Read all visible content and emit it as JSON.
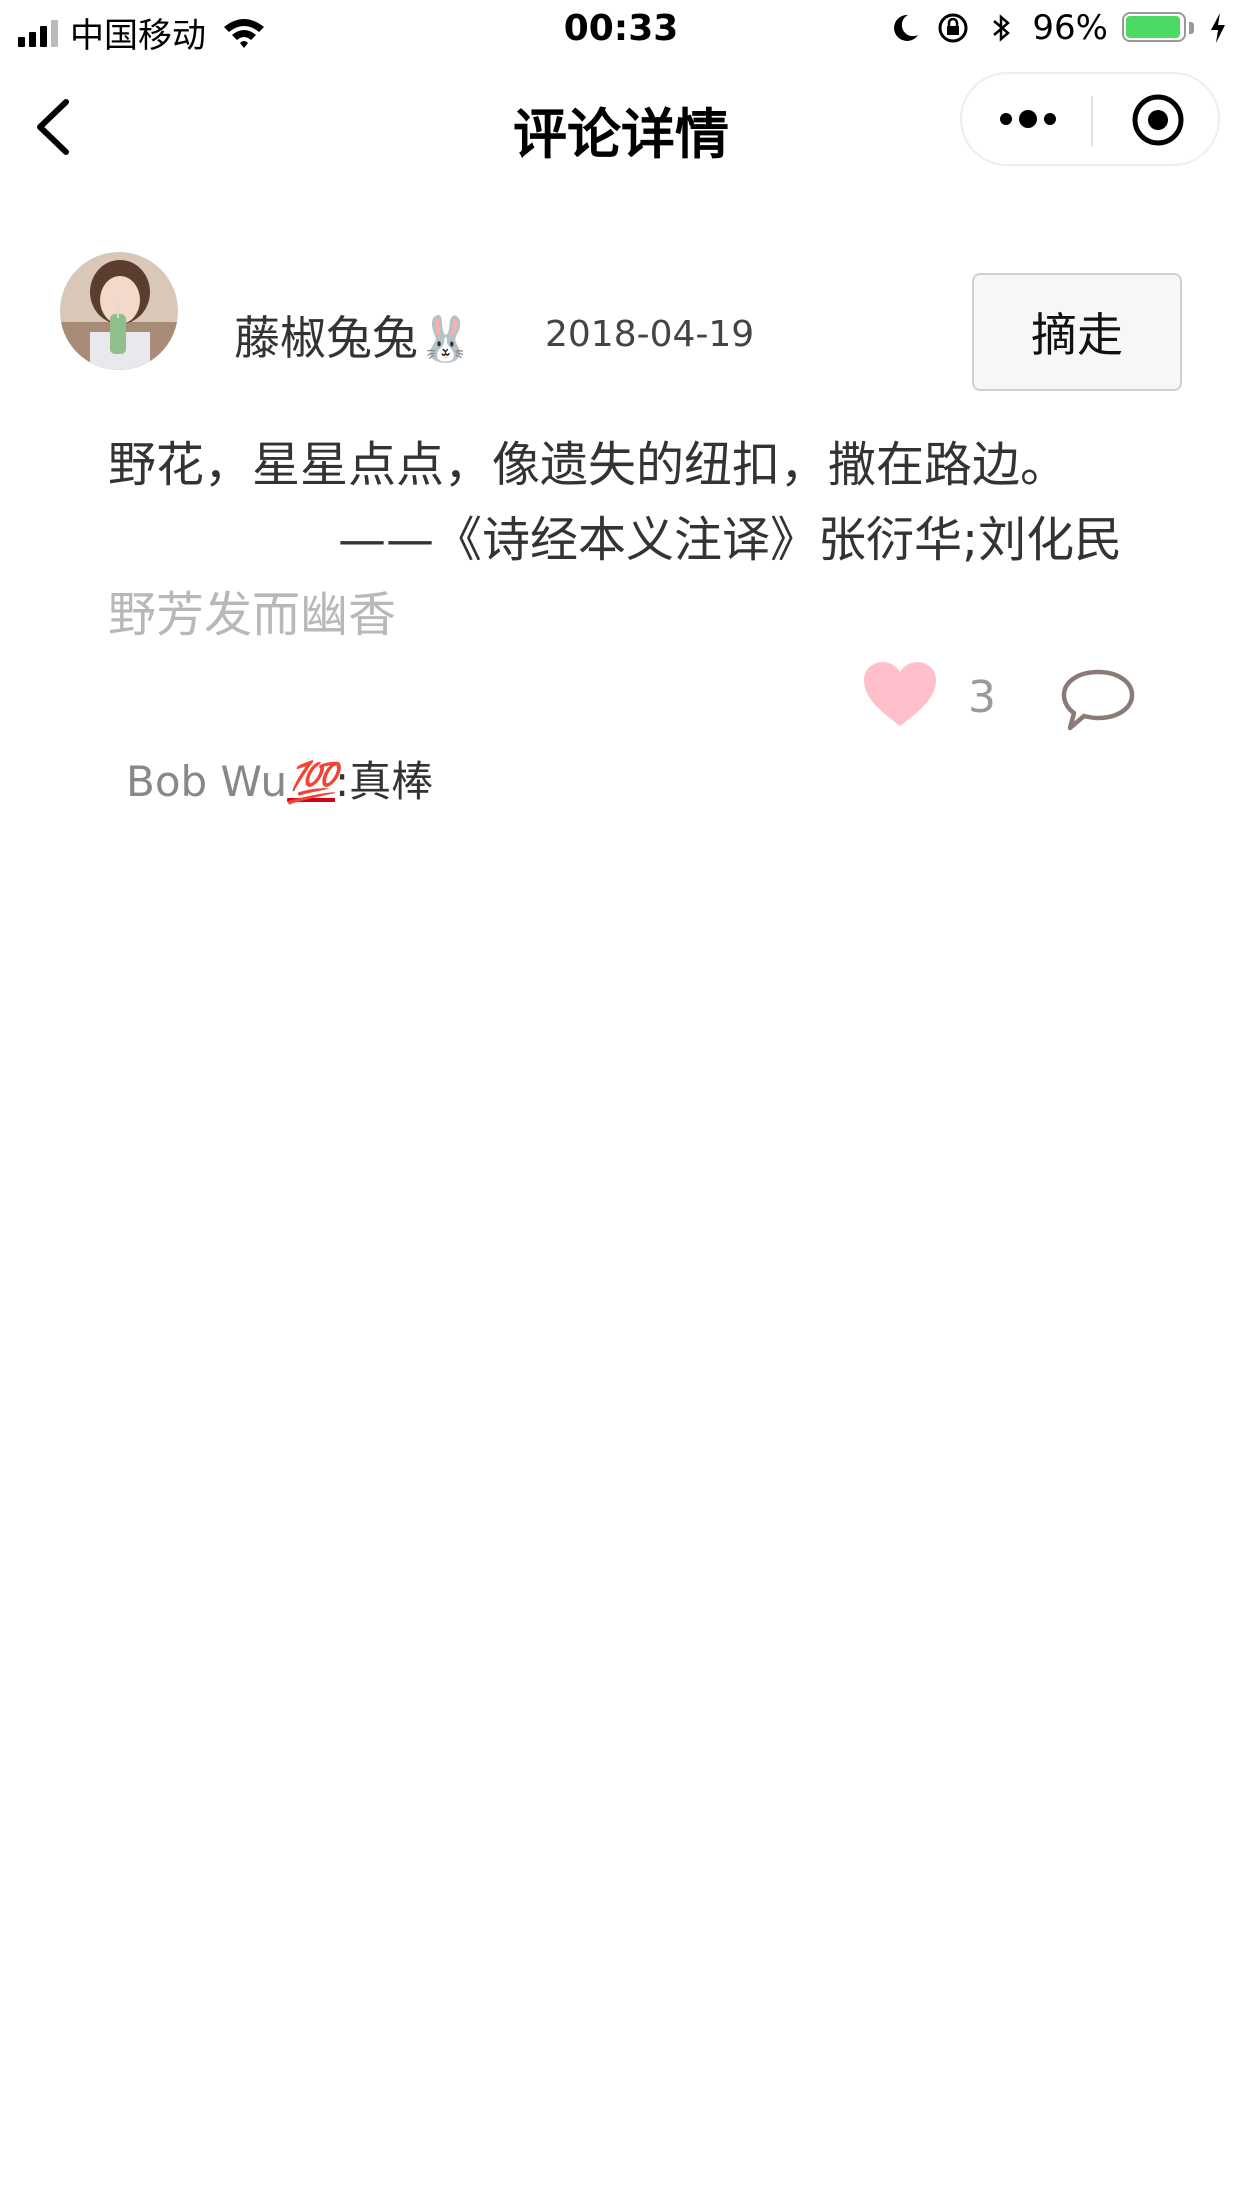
{
  "status_bar": {
    "carrier": "中国移动",
    "time": "00:33",
    "battery_percent": "96%",
    "battery_level": 0.96,
    "icons": [
      "signal-icon",
      "wifi-icon",
      "moon-icon",
      "rotation-lock-icon",
      "bluetooth-icon",
      "battery-icon",
      "charging-icon"
    ]
  },
  "nav": {
    "title": "评论详情",
    "back_icon": "chevron-left-icon",
    "capsule_icons": [
      "more-dots-icon",
      "target-icon"
    ]
  },
  "post": {
    "user_name": "藤椒兔兔",
    "user_emoji": "🐰",
    "date": "2018-04-19",
    "excerpt_button": "摘走",
    "quote_text": "野花，星星点点，像遗失的纽扣，撒在路边。",
    "quote_source": "——《诗经本义注译》张衍华;刘化民",
    "note": "野芳发而幽香",
    "like_count": "3"
  },
  "replies": [
    {
      "name": "Bob Wu",
      "emoji": "💯",
      "separator": ":",
      "text": "真棒"
    }
  ],
  "colors": {
    "like_heart": "#ffc0cb",
    "comment_icon": "#8b7b78",
    "battery_fill": "#4cd964"
  }
}
